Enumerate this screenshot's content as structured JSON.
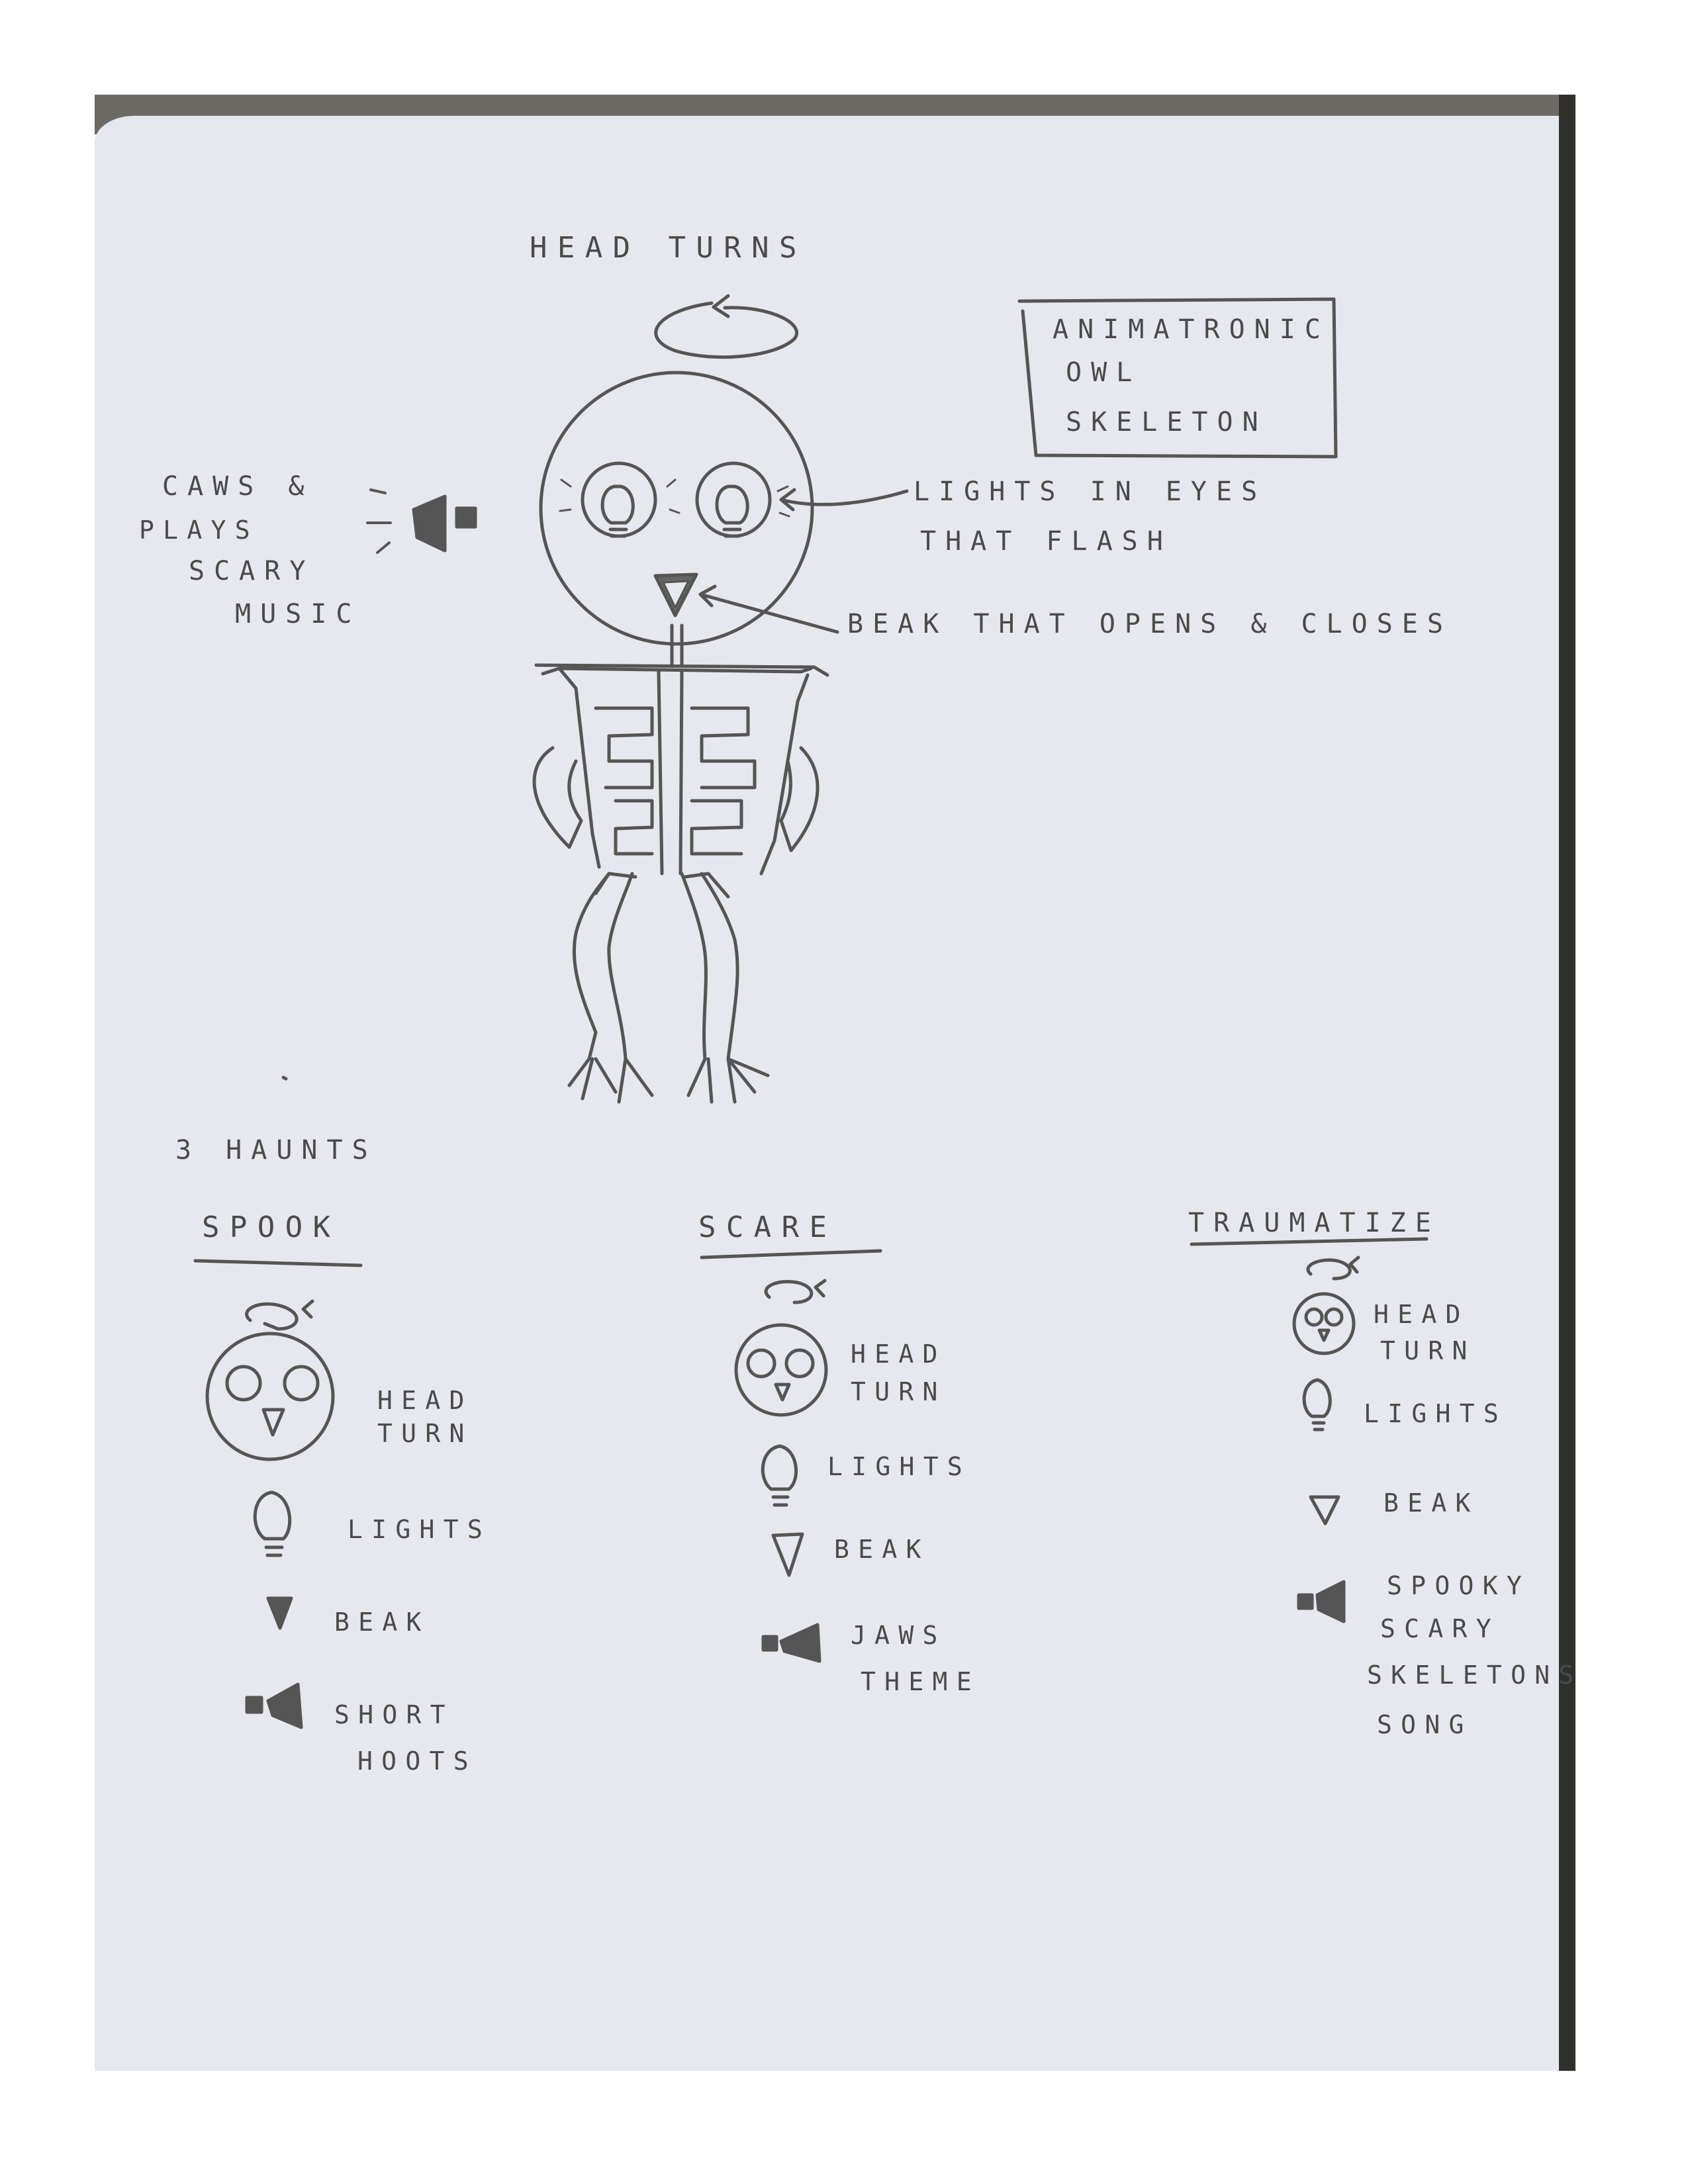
{
  "labels": {
    "head_turns": "HEAD TURNS",
    "title_box": [
      "ANIMATRONIC",
      "OWL",
      "SKELETON"
    ],
    "caws": [
      "CAWS &",
      "PLAYS",
      "SCARY",
      "MUSIC"
    ],
    "lights_eyes": [
      "LIGHTS IN EYES",
      "THAT FLASH"
    ],
    "beak_opens": "BEAK THAT OPENS & CLOSES",
    "three_haunts": "3 HAUNTS"
  },
  "haunts": [
    {
      "name": "SPOOK",
      "items": {
        "head": [
          "HEAD",
          "TURN"
        ],
        "lights": "LIGHTS",
        "beak": "BEAK",
        "sound": [
          "SHORT",
          "HOOTS"
        ]
      }
    },
    {
      "name": "SCARE",
      "items": {
        "head": [
          "HEAD",
          "TURN"
        ],
        "lights": "LIGHTS",
        "beak": "BEAK",
        "sound": [
          "JAWS",
          "THEME"
        ]
      }
    },
    {
      "name": "TRAUMATIZE",
      "items": {
        "head": [
          "HEAD",
          "TURN"
        ],
        "lights": "LIGHTS",
        "beak": "BEAK",
        "sound": [
          "SPOOKY",
          "SCARY",
          "SKELETONS",
          "SONG"
        ]
      }
    }
  ],
  "colors": {
    "paper": "#e7e8ef",
    "pencil": "#4a4a4a",
    "scan_edge": "#6d6a63"
  }
}
